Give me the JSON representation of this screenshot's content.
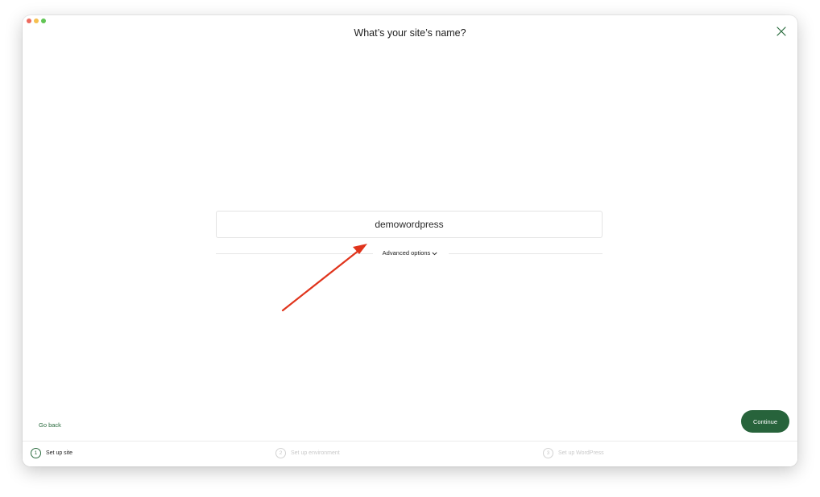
{
  "window": {
    "title": "What’s your site’s name?",
    "traffic_lights": {
      "close_color": "#ed6a5e",
      "minimize_color": "#f5bf4f",
      "maximize_color": "#61c554"
    }
  },
  "form": {
    "site_name_value": "demowordpress",
    "advanced_options_label": "Advanced options"
  },
  "navigation": {
    "go_back_label": "Go back",
    "continue_label": "Continue"
  },
  "steps": [
    {
      "number": "1",
      "label": "Set up site",
      "state": "active"
    },
    {
      "number": "2",
      "label": "Set up environment",
      "state": "inactive"
    },
    {
      "number": "3",
      "label": "Set up WordPress",
      "state": "inactive"
    }
  ],
  "colors": {
    "accent": "#2a6b3e",
    "continue_button": "#27633b",
    "annotation_arrow": "#e0341c"
  },
  "icons": {
    "close": "close-icon",
    "chevron": "chevron-down-icon"
  }
}
